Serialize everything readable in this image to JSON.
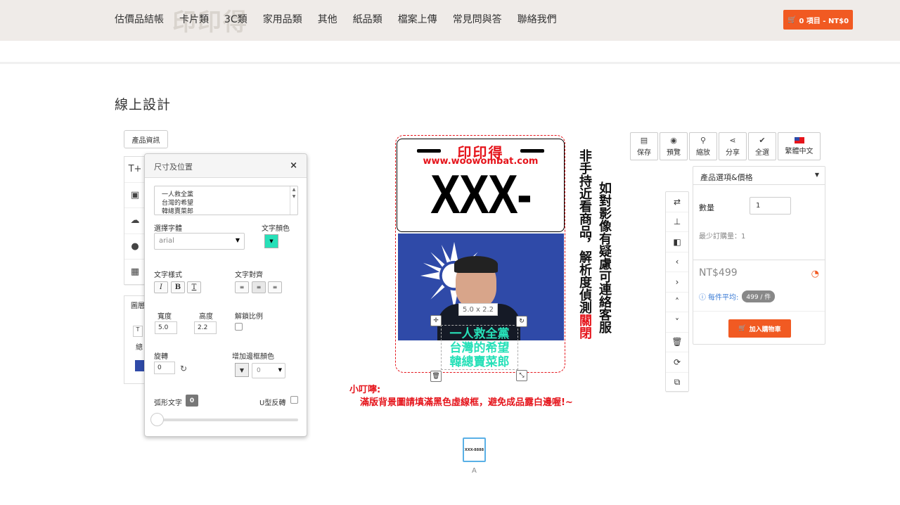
{
  "nav": {
    "logo_text": "印印得",
    "items": [
      "估價品結帳",
      "卡片類",
      "3C類",
      "家用品類",
      "其他",
      "紙品類",
      "檔案上傳",
      "常見問與答",
      "聯絡我們"
    ],
    "cart_label": "0 項目 - NT$0"
  },
  "page": {
    "title": "線上設計"
  },
  "left": {
    "product_tab": "產品資訊",
    "layer_tab_label": "圖層",
    "layer_item_text": "總"
  },
  "panel": {
    "title": "尺寸及位置",
    "close": "×",
    "text_content": "一人救全黨\n台灣的希望\n韓總賣菜郎",
    "font_label": "選擇字體",
    "font_value": "arial",
    "text_color_label": "文字顏色",
    "text_color": "#27e0b8",
    "style_label": "文字樣式",
    "style_buttons": [
      "I",
      "B",
      "T"
    ],
    "align_label": "文字對齊",
    "width_label": "寬度",
    "width_value": "5.0",
    "height_label": "高度",
    "height_value": "2.2",
    "unlock_label": "解鎖比例",
    "rotate_label": "旋轉",
    "rotate_value": "0",
    "border_color_label": "增加邊框顏色",
    "border_value": "0",
    "arc_label": "弧形文字",
    "arc_value": "0",
    "u_label": "U型反轉"
  },
  "canvas": {
    "brand": "印印得",
    "url": "www.woowombat.com",
    "plate_number": "XXX-8888",
    "overlay_lines": [
      "一人救全黨",
      "台灣的希望",
      "韓總賣菜郎"
    ],
    "dimension_label": "5.0 x 2.2",
    "vertical_col1": "非手持近看商品，解析度偵測",
    "vertical_col1_red": "關閉",
    "vertical_col2": "如對影像有疑慮可連絡客服",
    "notice_title": "小叮嚀:",
    "notice_body": "滿版背景圖請填滿黑色虛線框，避免成品露白邊喔!~",
    "accent_red": "#e5141b"
  },
  "thumbnail": {
    "image_text": "XXX-8888",
    "label": "A"
  },
  "toolbar": {
    "buttons": [
      "保存",
      "預覽",
      "縮放",
      "分享",
      "全選",
      "繁體中文"
    ]
  },
  "options": {
    "header": "產品選項&價格",
    "qty_label": "數量",
    "qty_value": "1",
    "min_order": "最少訂購量：1",
    "price": "NT$499",
    "per_unit_label": "每件平均:",
    "per_unit_value": "499 / 件",
    "add_to_cart": "加入購物車",
    "brand_orange": "#f15a22"
  }
}
